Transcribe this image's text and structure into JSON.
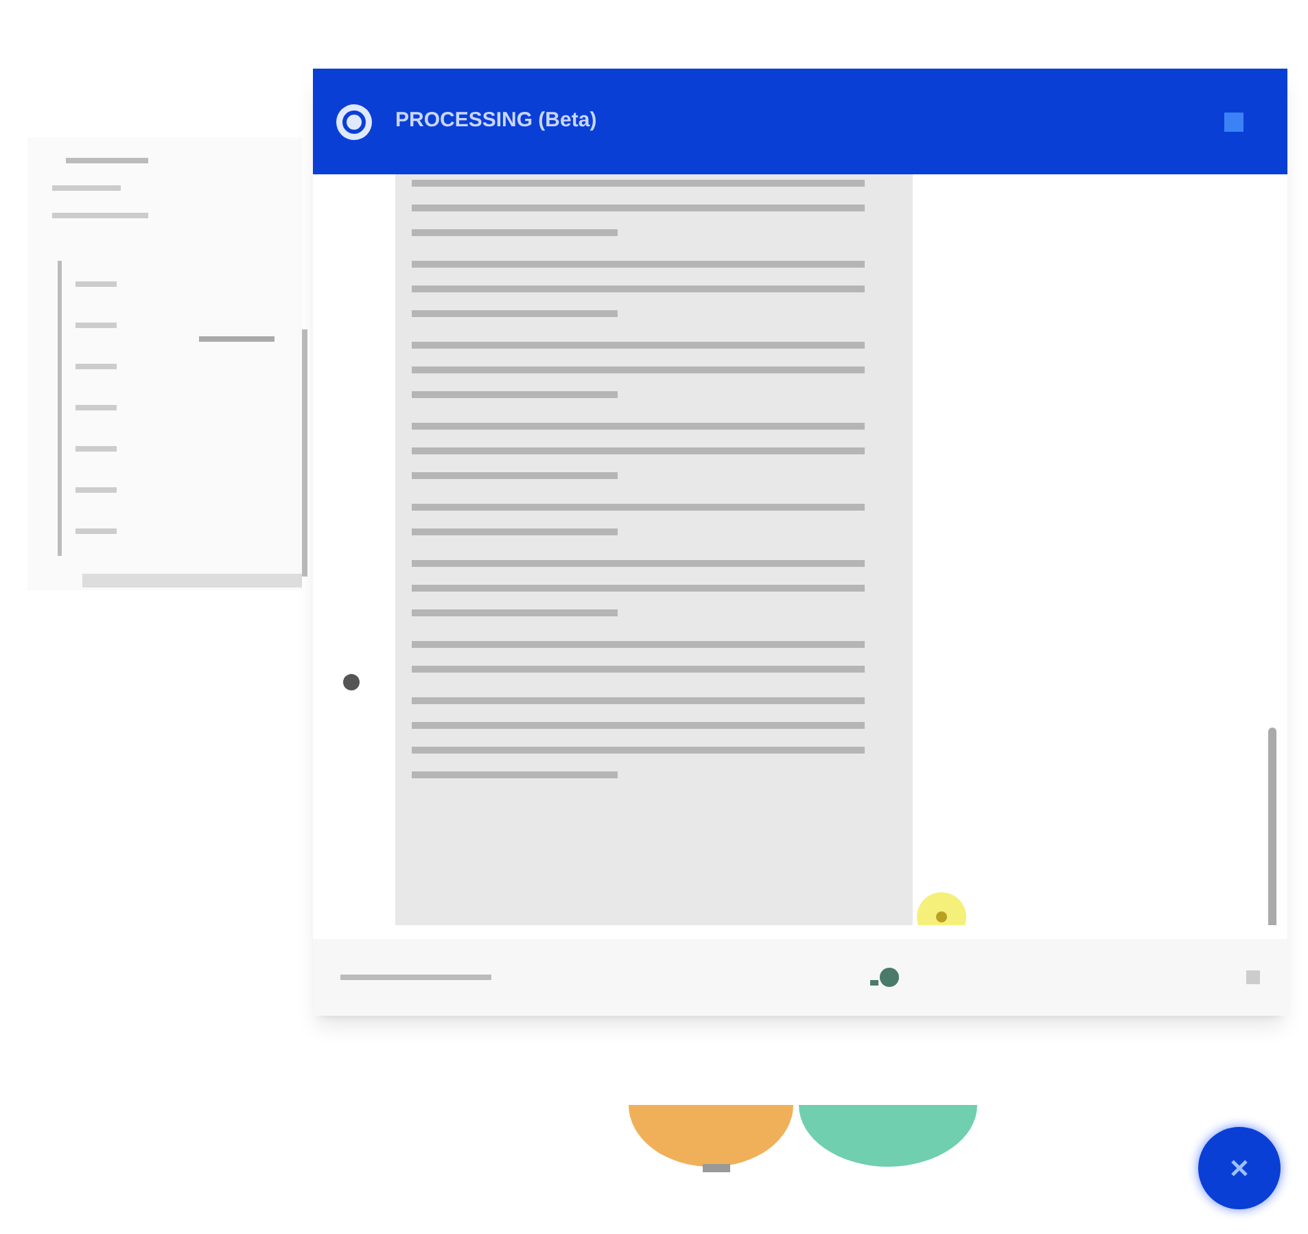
{
  "dialog": {
    "title": "PROCESSING (Beta)"
  },
  "message": {
    "paragraphs": [
      {
        "lines": [
          {
            "kind": "full"
          },
          {
            "kind": "full"
          },
          {
            "kind": "short"
          }
        ]
      },
      {
        "lines": [
          {
            "kind": "full"
          },
          {
            "kind": "full"
          },
          {
            "kind": "short"
          }
        ]
      },
      {
        "lines": [
          {
            "kind": "full"
          },
          {
            "kind": "full"
          },
          {
            "kind": "short"
          }
        ]
      },
      {
        "lines": [
          {
            "kind": "full"
          },
          {
            "kind": "full"
          },
          {
            "kind": "short"
          }
        ]
      },
      {
        "lines": [
          {
            "kind": "full"
          },
          {
            "kind": "short"
          }
        ]
      },
      {
        "lines": [
          {
            "kind": "full"
          },
          {
            "kind": "full"
          },
          {
            "kind": "short"
          }
        ]
      },
      {
        "lines": [
          {
            "kind": "full"
          },
          {
            "kind": "full"
          }
        ]
      },
      {
        "lines": [
          {
            "kind": "full"
          },
          {
            "kind": "full"
          },
          {
            "kind": "full"
          },
          {
            "kind": "short"
          }
        ]
      }
    ]
  }
}
